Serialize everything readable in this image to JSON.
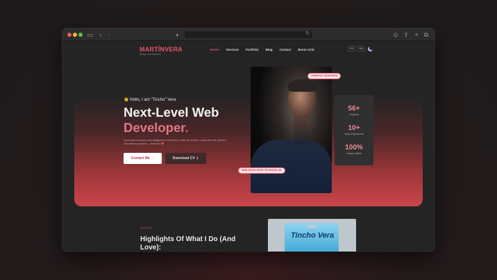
{
  "site": {
    "logo": {
      "name": "MARTÍNVERA",
      "tagline": "Design to Development"
    },
    "nav": [
      {
        "label": "Home",
        "active": true
      },
      {
        "label": "Services",
        "active": false
      },
      {
        "label": "Portfolio",
        "active": false
      },
      {
        "label": "Blog",
        "active": false
      },
      {
        "label": "Contact",
        "active": false
      },
      {
        "label": "Bento Grid",
        "active": false
      }
    ],
    "languages": [
      "ES",
      "EN"
    ],
    "theme_icon": "moon-icon"
  },
  "hero": {
    "greeting": "👋 Hello, I am \"Tincho\" Vera",
    "headline_line1": "Next-Level Web",
    "headline_line2": "Developer",
    "headline_dot": ".",
    "description": "If you want someone who designs the experience, builds the product, automates the pipeline, and delivers properly — that's me ❤️",
    "contact_button": "Contact Me →",
    "cv_button": "Download CV ⇣",
    "tag_graphic": "GRAPHIC DESIGNER",
    "tag_web": "WEB DEVELOPER TECHNOPLAN"
  },
  "stats": [
    {
      "value": "56+",
      "label": "Projects"
    },
    {
      "value": "10+",
      "label": "Years Experience"
    },
    {
      "value": "100%",
      "label": "Happy Clients"
    }
  ],
  "about": {
    "kicker": "About Me",
    "title": "Highlights Of What I Do (And Love):"
  },
  "product": {
    "label": "Tincho Vera"
  },
  "colors": {
    "accent": "#e2566a",
    "hero_gradient_end": "#c9454a",
    "stat_value": "#ec8c98",
    "background": "#242424"
  }
}
